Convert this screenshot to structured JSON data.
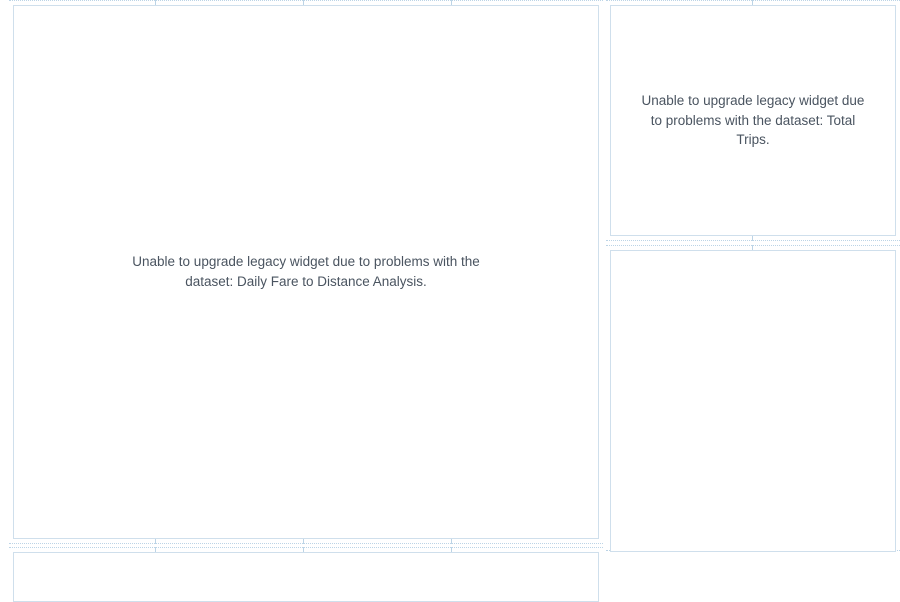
{
  "widgets": {
    "left_main": {
      "error_message": "Unable to upgrade legacy widget due to problems with the dataset: Daily Fare to Distance Analysis."
    },
    "right_top": {
      "error_message": "Unable to upgrade legacy widget due to problems with the dataset: Total Trips."
    },
    "right_bottom": {
      "error_message": ""
    },
    "left_lower": {
      "error_message": ""
    }
  }
}
